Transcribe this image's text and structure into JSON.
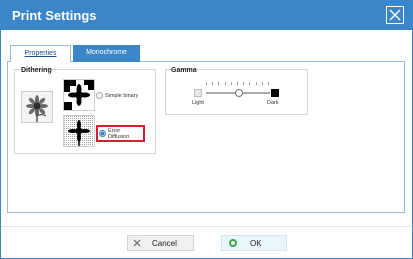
{
  "window": {
    "title": "Print Settings"
  },
  "tabs": [
    {
      "label": "Properties",
      "active": false
    },
    {
      "label": "Monochrome",
      "active": true
    }
  ],
  "dithering": {
    "title": "Dithering",
    "options": [
      {
        "label": "Simple binary",
        "selected": false
      },
      {
        "label": "Error Diffusion",
        "selected": true
      }
    ]
  },
  "gamma": {
    "title": "Gamma",
    "min_label": "Light",
    "max_label": "Dark",
    "slider_fraction": 0.5
  },
  "buttons": {
    "cancel": "Cancel",
    "ok": "OK"
  },
  "colors": {
    "accent": "#3a86c8",
    "highlight": "#d81e2c",
    "ok_icon": "#43a047"
  },
  "icons": [
    "close-icon",
    "cancel-x-icon",
    "ok-circle-icon"
  ]
}
